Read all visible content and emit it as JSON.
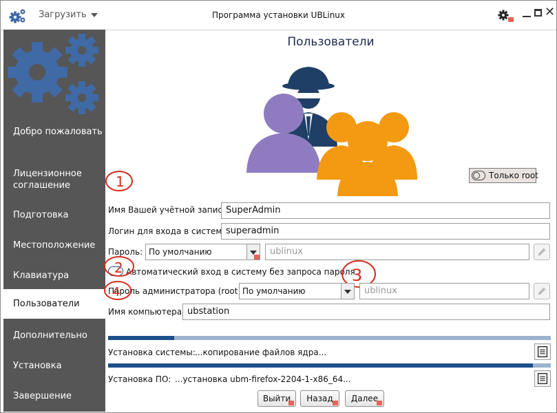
{
  "titlebar": {
    "load_menu": "Загрузить",
    "title": "Программа установки UBLinux"
  },
  "sidebar": {
    "items": [
      {
        "label": "Добро пожаловать",
        "active": false
      },
      {
        "label": "Лицензионное соглашение",
        "active": false
      },
      {
        "label": "Подготовка",
        "active": false
      },
      {
        "label": "Местоположение",
        "active": false
      },
      {
        "label": "Клавиатура",
        "active": false
      },
      {
        "label": "Пользователи",
        "active": true
      },
      {
        "label": "Дополнительно",
        "active": false
      },
      {
        "label": "Установка",
        "active": false
      },
      {
        "label": "Завершение",
        "active": false
      }
    ]
  },
  "main": {
    "title": "Пользователи",
    "root_toggle_label": "Только root",
    "account_name_label": "Имя Вашей учётной записи:",
    "account_name_value": "SuperAdmin",
    "login_label": "Логин для входа в систему:",
    "login_value": "superadmin",
    "password_label": "Пароль:",
    "password_mode": "По умолчанию",
    "password_placeholder": "ublinux",
    "autologin_label": "Автоматический вход в систему без запроса пароля",
    "root_password_label": "Пароль администратора (root):",
    "root_password_mode": "По умолчанию",
    "root_password_placeholder": "ublinux",
    "hostname_label": "Имя компьютера:",
    "hostname_value": "ubstation"
  },
  "annotations": [
    "1",
    "2",
    "3",
    "4"
  ],
  "progress": {
    "system_label": "Установка системы:",
    "system_status": "...копирование файлов ядра...",
    "system_fraction": 0.15,
    "software_label": "Установка ПО:",
    "software_status": "...установка ubm-firefox-2204-1-x86_64...",
    "software_fraction": 0.96
  },
  "buttons": {
    "exit": "Выйти",
    "back": "Назад",
    "next": "Далее"
  },
  "colors": {
    "sidebar_bg": "#565656",
    "gear_blue": "#3f6aa6",
    "progress_dark": "#1c4f8a",
    "progress_light": "#9ab2cc",
    "annotation_red": "#d42c1c",
    "user_purple": "#8f7cc0",
    "user_orange": "#f39a12",
    "spy_navy": "#1f3f66"
  }
}
